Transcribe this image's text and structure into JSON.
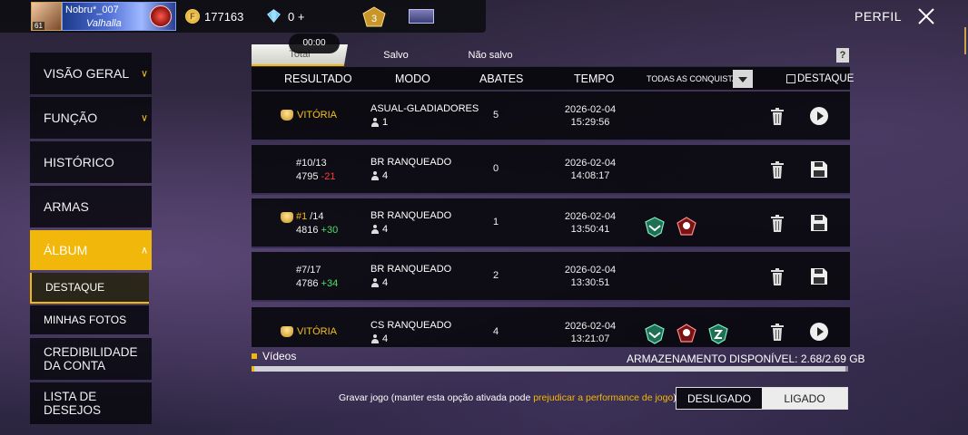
{
  "header": {
    "player_name": "Nobru*_007",
    "guild_name": "Valhalla",
    "player_level": "61",
    "gold": "177163",
    "diamonds": "0",
    "diamond_add": "+",
    "rank_badge": "3",
    "perfil_label": "PERFIL"
  },
  "sidebar": {
    "items": [
      {
        "label": "VISÃO GERAL"
      },
      {
        "label": "FUNÇÃO"
      },
      {
        "label": "HISTÓRICO"
      },
      {
        "label": "ARMAS"
      },
      {
        "label": "ÁLBUM"
      }
    ],
    "album_sub": [
      {
        "label": "DESTAQUE"
      },
      {
        "label": "MINHAS FOTOS"
      }
    ],
    "credibility": {
      "line1": "CREDIBILIDADE",
      "line2": "DA CONTA"
    },
    "wishlist": {
      "line1": "LISTA DE",
      "line2": "DESEJOS"
    }
  },
  "tabs": {
    "active_label": "Total",
    "saved": "Salvo",
    "unsaved": "Não salvo",
    "help": "?",
    "timer": "00:00"
  },
  "table": {
    "headers": {
      "result": "RESULTADO",
      "mode": "MODO",
      "kills": "ABATES",
      "time": "TEMPO",
      "achievements": "TODAS AS CONQUISTAS",
      "highlight": "DESTAQUE"
    },
    "rows": [
      {
        "result": "VITÓRIA",
        "mode": "ASUAL-GLADIADORES FF",
        "players": "1",
        "kills": "5",
        "date": "2026-02-04",
        "time": "15:29:56"
      },
      {
        "rank": "#10",
        "total": "/13",
        "score": "4795",
        "delta": "-21",
        "mode": "BR RANQUEADO",
        "players": "4",
        "kills": "0",
        "date": "2026-02-04",
        "time": "14:08:17"
      },
      {
        "rank": "#1",
        "total": "/14",
        "score": "4816",
        "delta": "+30",
        "mode": "BR RANQUEADO",
        "players": "4",
        "kills": "1",
        "date": "2026-02-04",
        "time": "13:50:41"
      },
      {
        "rank": "#7",
        "total": "/17",
        "score": "4786",
        "delta": "+34",
        "mode": "BR RANQUEADO",
        "players": "4",
        "kills": "2",
        "date": "2026-02-04",
        "time": "13:30:51"
      },
      {
        "result": "VITÓRIA",
        "mode": "CS RANQUEADO",
        "players": "4",
        "kills": "4",
        "date": "2026-02-04",
        "time": "13:21:07"
      }
    ]
  },
  "storage": {
    "videos_label": "Vídeos",
    "label": "ARMAZENAMENTO DISPONÍVEL:",
    "value": "2.68/2.69 GB"
  },
  "record": {
    "text": "Gravar jogo (manter esta opção ativada pode ",
    "warn": "prejudicar a performance de jogo",
    "end": ").",
    "off": "DESLIGADO",
    "on": "LIGADO"
  }
}
